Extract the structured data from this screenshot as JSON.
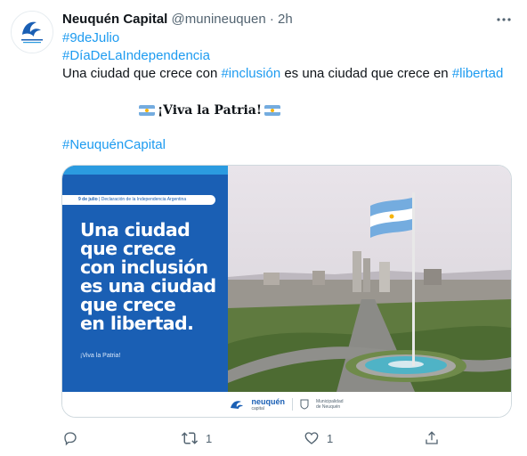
{
  "author": {
    "name": "Neuquén Capital",
    "handle": "@munineuquen",
    "separator": "·",
    "time": "2h"
  },
  "tweet": {
    "hashtag1": "#9deJulio",
    "hashtag2": "#DíaDeLaIndependencia",
    "line3_part1": "Una ciudad que crece con ",
    "line3_link1": "#inclusión",
    "line3_part2": " es una ciudad que crece en ",
    "line3_link2": "#libertad",
    "viva": "¡Viva la Patria!",
    "hashtag3": "#NeuquénCapital"
  },
  "card": {
    "date_pill_bold": "9 de julio",
    "date_pill_rest": " | Declaración de la Independencia Argentina",
    "headline_lines": [
      "Una ciudad",
      "que crece",
      "con inclusión",
      "es una ciudad",
      "que crece",
      "en libertad."
    ],
    "small_viva": "¡Viva la Patria!",
    "logo_name": "neuquén",
    "logo_sub": "capital",
    "muni_line1": "Municipalidad",
    "muni_line2": "de Neuquén"
  },
  "actions": {
    "reply_icon": "reply-icon",
    "retweet_icon": "retweet-icon",
    "retweet_count": "1",
    "like_icon": "heart-icon",
    "like_count": "1",
    "share_icon": "share-icon"
  },
  "colors": {
    "link": "#1d9bf0",
    "secondary_text": "#536471",
    "card_blue": "#1a5fb4",
    "card_light_blue": "#2b9be0"
  }
}
